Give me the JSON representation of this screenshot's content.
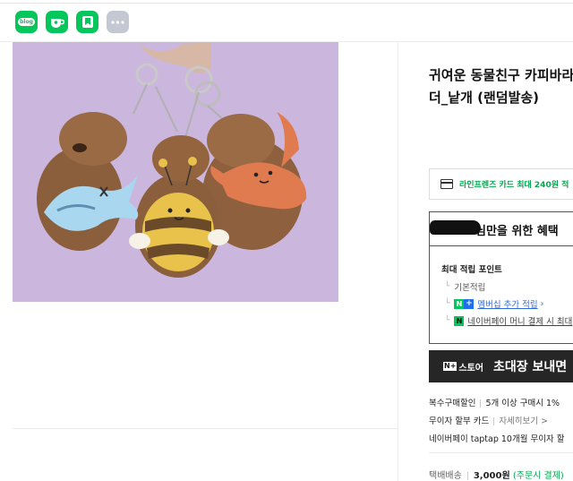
{
  "share": {
    "blog_label": "blog"
  },
  "product": {
    "title_line1": "귀여운 동물친구 카피바라",
    "title_line2": "더_낱개 (랜덤발송)"
  },
  "card_benefit": {
    "text": "라인프렌즈 카드 최대 240원 적"
  },
  "benefit": {
    "title": "님만을 위한 혜택",
    "max_points_label": "최대 적립 포인트",
    "basic_points": "기본적립",
    "membership_extra": "멤버십 추가 적립",
    "naverpay_money": "네이버페이 머니 결제 시 최대"
  },
  "store_banner": {
    "logo_text": "스토어",
    "text": "초대장 보내면"
  },
  "info": {
    "multi_buy_label": "복수구매할인",
    "multi_buy_value": "5개 이상 구매시 1%",
    "installment_label": "무이자 할부 카드",
    "installment_link": "자세히보기 >",
    "taptap_text": "네이버페이 taptap 10개월 무이자 할"
  },
  "shipping": {
    "label": "택배배송",
    "price": "3,000원",
    "note": "(주문시 결제)"
  }
}
